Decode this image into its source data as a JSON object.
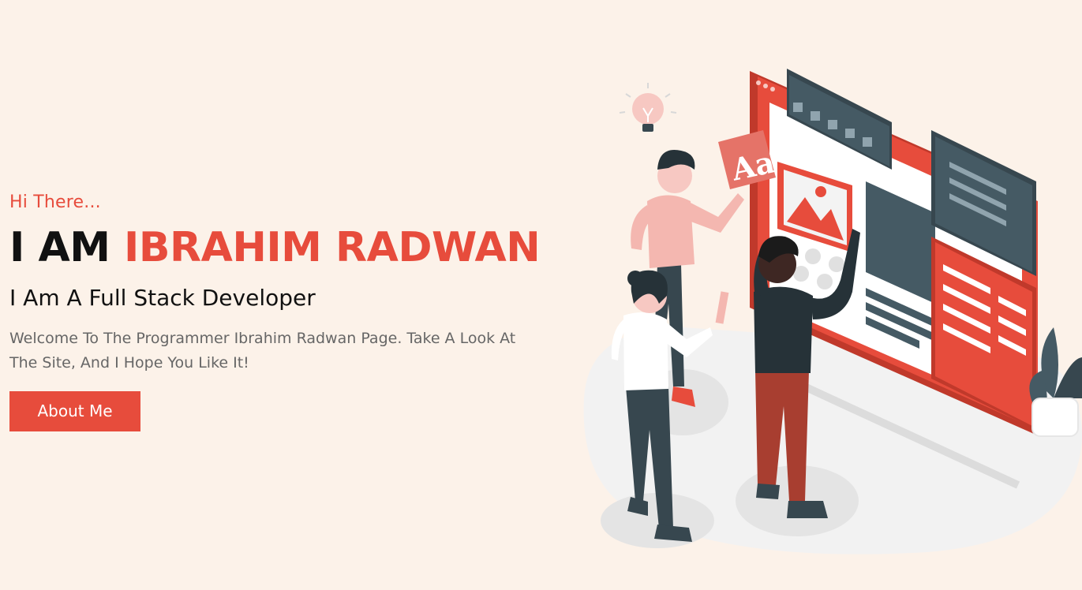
{
  "hero": {
    "greeting": "Hi There...",
    "headline_prefix": "I AM ",
    "headline_name": "IBRAHIM RADWAN",
    "subtitle": "I Am A Full Stack Developer",
    "description": "Welcome To The Programmer Ibrahim Radwan Page. Take A Look At The Site, And I Hope You Like It!",
    "cta_label": "About Me"
  },
  "illustration": {
    "font_card_text": "Aa"
  },
  "colors": {
    "background": "#fcf2e9",
    "accent": "#e74c3c",
    "heading": "#111111",
    "body_text": "#666666",
    "dark_panel": "#455a64"
  }
}
